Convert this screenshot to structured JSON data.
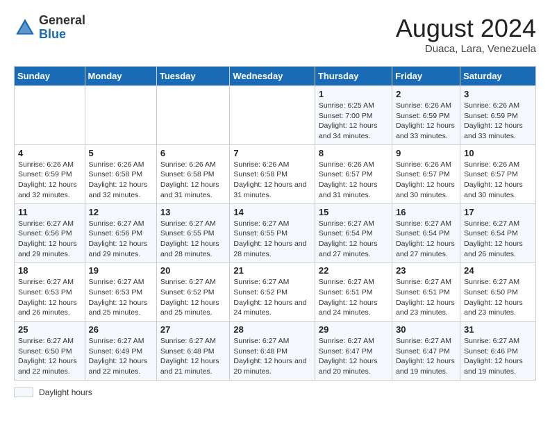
{
  "header": {
    "logo_general": "General",
    "logo_blue": "Blue",
    "month_year": "August 2024",
    "location": "Duaca, Lara, Venezuela"
  },
  "weekdays": [
    "Sunday",
    "Monday",
    "Tuesday",
    "Wednesday",
    "Thursday",
    "Friday",
    "Saturday"
  ],
  "legend_label": "Daylight hours",
  "weeks": [
    [
      {
        "day": "",
        "detail": ""
      },
      {
        "day": "",
        "detail": ""
      },
      {
        "day": "",
        "detail": ""
      },
      {
        "day": "",
        "detail": ""
      },
      {
        "day": "1",
        "detail": "Sunrise: 6:25 AM\nSunset: 7:00 PM\nDaylight: 12 hours\nand 34 minutes."
      },
      {
        "day": "2",
        "detail": "Sunrise: 6:26 AM\nSunset: 6:59 PM\nDaylight: 12 hours\nand 33 minutes."
      },
      {
        "day": "3",
        "detail": "Sunrise: 6:26 AM\nSunset: 6:59 PM\nDaylight: 12 hours\nand 33 minutes."
      }
    ],
    [
      {
        "day": "4",
        "detail": "Sunrise: 6:26 AM\nSunset: 6:59 PM\nDaylight: 12 hours\nand 32 minutes."
      },
      {
        "day": "5",
        "detail": "Sunrise: 6:26 AM\nSunset: 6:58 PM\nDaylight: 12 hours\nand 32 minutes."
      },
      {
        "day": "6",
        "detail": "Sunrise: 6:26 AM\nSunset: 6:58 PM\nDaylight: 12 hours\nand 31 minutes."
      },
      {
        "day": "7",
        "detail": "Sunrise: 6:26 AM\nSunset: 6:58 PM\nDaylight: 12 hours\nand 31 minutes."
      },
      {
        "day": "8",
        "detail": "Sunrise: 6:26 AM\nSunset: 6:57 PM\nDaylight: 12 hours\nand 31 minutes."
      },
      {
        "day": "9",
        "detail": "Sunrise: 6:26 AM\nSunset: 6:57 PM\nDaylight: 12 hours\nand 30 minutes."
      },
      {
        "day": "10",
        "detail": "Sunrise: 6:26 AM\nSunset: 6:57 PM\nDaylight: 12 hours\nand 30 minutes."
      }
    ],
    [
      {
        "day": "11",
        "detail": "Sunrise: 6:27 AM\nSunset: 6:56 PM\nDaylight: 12 hours\nand 29 minutes."
      },
      {
        "day": "12",
        "detail": "Sunrise: 6:27 AM\nSunset: 6:56 PM\nDaylight: 12 hours\nand 29 minutes."
      },
      {
        "day": "13",
        "detail": "Sunrise: 6:27 AM\nSunset: 6:55 PM\nDaylight: 12 hours\nand 28 minutes."
      },
      {
        "day": "14",
        "detail": "Sunrise: 6:27 AM\nSunset: 6:55 PM\nDaylight: 12 hours\nand 28 minutes."
      },
      {
        "day": "15",
        "detail": "Sunrise: 6:27 AM\nSunset: 6:54 PM\nDaylight: 12 hours\nand 27 minutes."
      },
      {
        "day": "16",
        "detail": "Sunrise: 6:27 AM\nSunset: 6:54 PM\nDaylight: 12 hours\nand 27 minutes."
      },
      {
        "day": "17",
        "detail": "Sunrise: 6:27 AM\nSunset: 6:54 PM\nDaylight: 12 hours\nand 26 minutes."
      }
    ],
    [
      {
        "day": "18",
        "detail": "Sunrise: 6:27 AM\nSunset: 6:53 PM\nDaylight: 12 hours\nand 26 minutes."
      },
      {
        "day": "19",
        "detail": "Sunrise: 6:27 AM\nSunset: 6:53 PM\nDaylight: 12 hours\nand 25 minutes."
      },
      {
        "day": "20",
        "detail": "Sunrise: 6:27 AM\nSunset: 6:52 PM\nDaylight: 12 hours\nand 25 minutes."
      },
      {
        "day": "21",
        "detail": "Sunrise: 6:27 AM\nSunset: 6:52 PM\nDaylight: 12 hours\nand 24 minutes."
      },
      {
        "day": "22",
        "detail": "Sunrise: 6:27 AM\nSunset: 6:51 PM\nDaylight: 12 hours\nand 24 minutes."
      },
      {
        "day": "23",
        "detail": "Sunrise: 6:27 AM\nSunset: 6:51 PM\nDaylight: 12 hours\nand 23 minutes."
      },
      {
        "day": "24",
        "detail": "Sunrise: 6:27 AM\nSunset: 6:50 PM\nDaylight: 12 hours\nand 23 minutes."
      }
    ],
    [
      {
        "day": "25",
        "detail": "Sunrise: 6:27 AM\nSunset: 6:50 PM\nDaylight: 12 hours\nand 22 minutes."
      },
      {
        "day": "26",
        "detail": "Sunrise: 6:27 AM\nSunset: 6:49 PM\nDaylight: 12 hours\nand 22 minutes."
      },
      {
        "day": "27",
        "detail": "Sunrise: 6:27 AM\nSunset: 6:48 PM\nDaylight: 12 hours\nand 21 minutes."
      },
      {
        "day": "28",
        "detail": "Sunrise: 6:27 AM\nSunset: 6:48 PM\nDaylight: 12 hours\nand 20 minutes."
      },
      {
        "day": "29",
        "detail": "Sunrise: 6:27 AM\nSunset: 6:47 PM\nDaylight: 12 hours\nand 20 minutes."
      },
      {
        "day": "30",
        "detail": "Sunrise: 6:27 AM\nSunset: 6:47 PM\nDaylight: 12 hours\nand 19 minutes."
      },
      {
        "day": "31",
        "detail": "Sunrise: 6:27 AM\nSunset: 6:46 PM\nDaylight: 12 hours\nand 19 minutes."
      }
    ]
  ]
}
